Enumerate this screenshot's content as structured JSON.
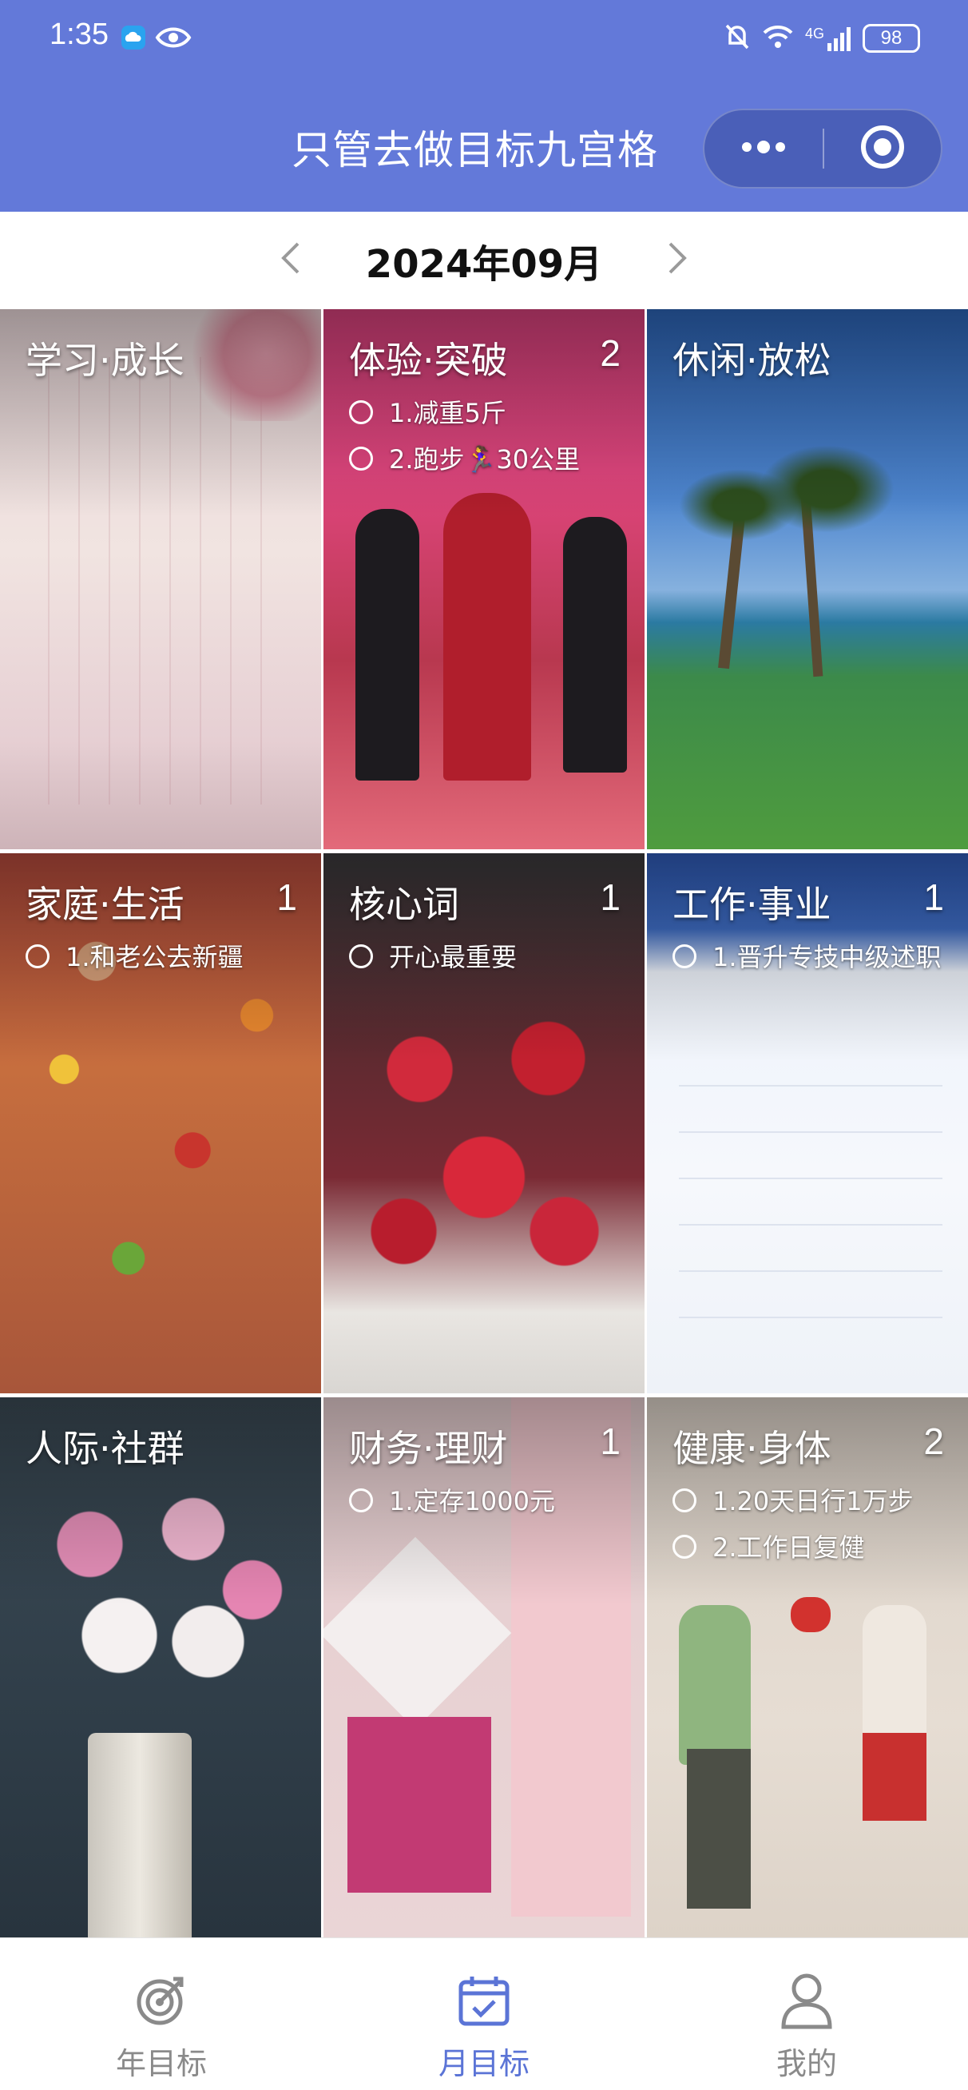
{
  "status_bar": {
    "time": "1:35",
    "network": "4G",
    "battery": "98",
    "icons": [
      "cloud-icon",
      "eye-icon",
      "mute-icon",
      "wifi-icon",
      "signal-icon",
      "battery-icon"
    ]
  },
  "header": {
    "title": "只管去做目标九宫格",
    "background": "#6379d9",
    "capsule_icons": [
      "more-icon",
      "target-icon"
    ]
  },
  "month_nav": {
    "label": "2024年09月",
    "prev_icon": "chevron-left-icon",
    "next_icon": "chevron-right-icon"
  },
  "grid": {
    "cells": [
      {
        "title": "学习·成长",
        "count": "",
        "goals": []
      },
      {
        "title": "体验·突破",
        "count": "2",
        "goals": [
          "1.减重5斤",
          "2.跑步🏃‍♀️30公里"
        ]
      },
      {
        "title": "休闲·放松",
        "count": "",
        "goals": []
      },
      {
        "title": "家庭·生活",
        "count": "1",
        "goals": [
          "1.和老公去新疆"
        ]
      },
      {
        "title": "核心词",
        "count": "1",
        "goals": [
          "开心最重要"
        ]
      },
      {
        "title": "工作·事业",
        "count": "1",
        "goals": [
          "1.晋升专技中级述职"
        ]
      },
      {
        "title": "人际·社群",
        "count": "",
        "goals": []
      },
      {
        "title": "财务·理财",
        "count": "1",
        "goals": [
          "1.定存1000元"
        ]
      },
      {
        "title": "健康·身体",
        "count": "2",
        "goals": [
          "1.20天日行1万步",
          "2.工作日复健"
        ]
      }
    ]
  },
  "tabbar": {
    "tabs": [
      {
        "label": "年目标",
        "icon": "target-dart-icon",
        "active": false
      },
      {
        "label": "月目标",
        "icon": "calendar-check-icon",
        "active": true
      },
      {
        "label": "我的",
        "icon": "user-icon",
        "active": false
      }
    ],
    "active_color": "#5b74d6",
    "inactive_color": "#8a8a8a"
  }
}
